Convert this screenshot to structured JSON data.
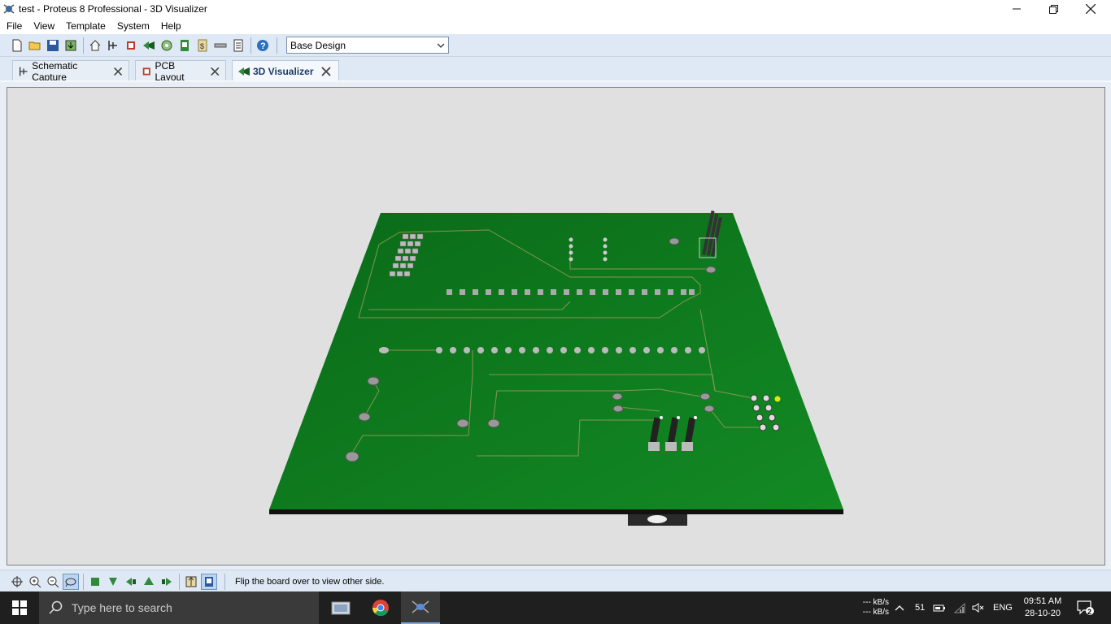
{
  "window": {
    "title": "test - Proteus 8 Professional - 3D Visualizer"
  },
  "menu": [
    "File",
    "View",
    "Template",
    "System",
    "Help"
  ],
  "toolbar": {
    "icons": [
      "new-file-icon",
      "open-folder-icon",
      "save-icon",
      "import-icon",
      "home-icon",
      "schematic-icon",
      "pcb-icon",
      "3d-visualizer-icon",
      "gerber-icon",
      "bom-icon",
      "design-explorer-icon",
      "netlist-icon",
      "notes-icon",
      "help-icon"
    ],
    "variant_select": "Base Design"
  },
  "tabs": [
    {
      "label": "Schematic Capture",
      "icon": "schematic-icon",
      "active": false
    },
    {
      "label": "PCB Layout",
      "icon": "pcb-chip-icon",
      "active": false
    },
    {
      "label": "3D Visualizer",
      "icon": "3d-visualizer-icon",
      "active": true
    }
  ],
  "bottom_toolbar": {
    "icons": [
      "center-icon",
      "zoom-in-icon",
      "zoom-out-icon",
      "zoom-extents-icon",
      "view-top-icon",
      "view-front-icon",
      "view-left-icon",
      "view-back-icon",
      "view-right-icon",
      "flip-board-icon",
      "toggle-components-icon"
    ],
    "status": "Flip the board over to view other side."
  },
  "taskbar": {
    "search_placeholder": "Type here to search",
    "apps": [
      "file-manager-icon",
      "chrome-icon",
      "proteus-icon"
    ],
    "net_up": "--- kB/s",
    "net_down": "--- kB/s",
    "tray_number": "51",
    "language": "ENG",
    "time": "09:51 AM",
    "date": "28-10-20",
    "notification_count": "2"
  },
  "colors": {
    "pcb_green": "#0d7a1e",
    "background_gray": "#e0e0e0",
    "toolbar_blue": "#dfe9f5",
    "taskbar": "#1f1f1f"
  }
}
